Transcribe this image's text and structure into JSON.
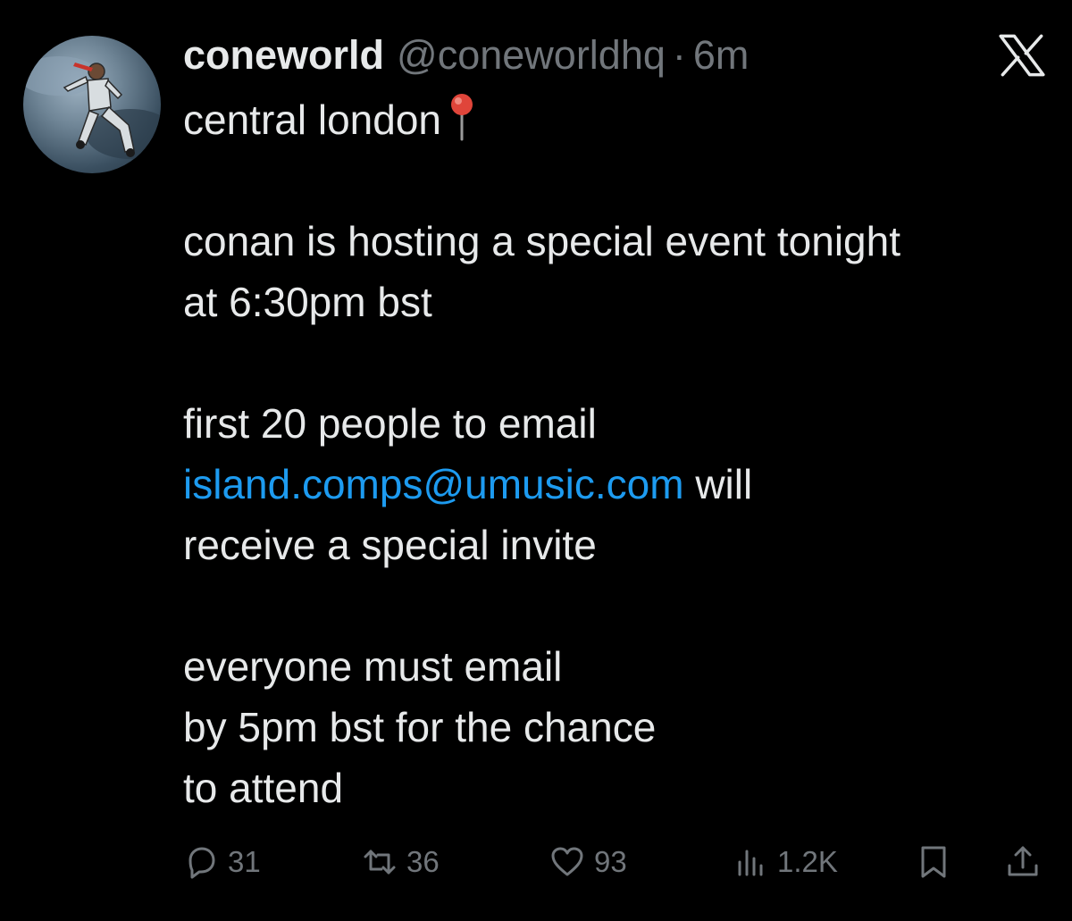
{
  "post": {
    "display_name": "coneworld",
    "handle": "@coneworldhq",
    "separator": "·",
    "time": "6m",
    "platform_icon": "x-logo-icon",
    "avatar_icon": "profile-avatar",
    "lines": [
      "central london",
      "",
      "conan is hosting a special event tonight",
      "at 6:30pm bst",
      "",
      "first 20 people to email",
      "island.comps@umusic.com",
      " will",
      "receive a special invite",
      "",
      "everyone must email",
      "by 5pm bst for the chance",
      "to attend"
    ],
    "location_emoji": "round-pushpin-icon",
    "link_color": "#1d9bf0"
  },
  "actions": {
    "reply_count": "31",
    "repost_count": "36",
    "like_count": "93",
    "views_count": "1.2K",
    "icons": {
      "reply": "reply-icon",
      "repost": "repost-icon",
      "like": "heart-icon",
      "views": "views-icon",
      "bookmark": "bookmark-icon",
      "share": "share-icon"
    }
  },
  "colors": {
    "background": "#000000",
    "text_primary": "#e7e9ea",
    "text_secondary": "#71767b",
    "link": "#1d9bf0"
  }
}
